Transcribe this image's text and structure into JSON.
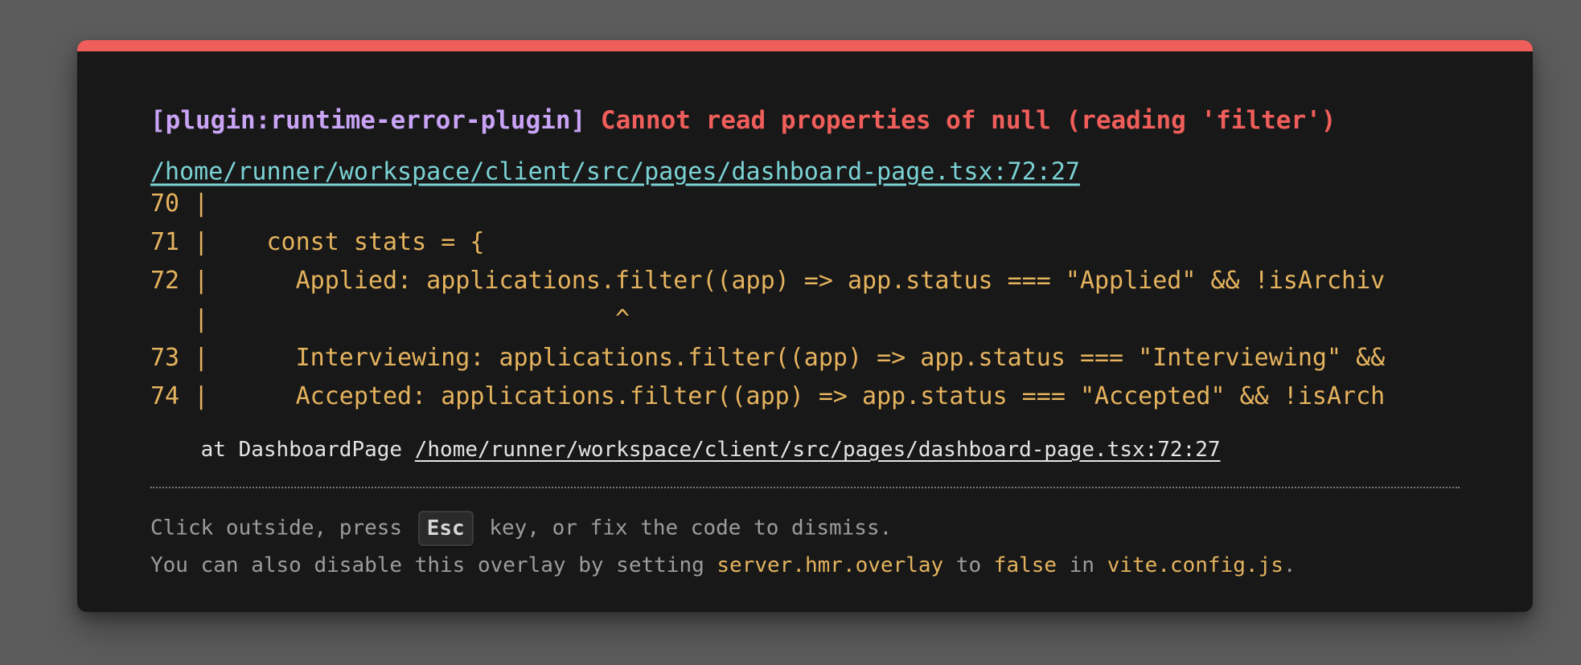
{
  "overlay": {
    "plugin": "[plugin:runtime-error-plugin]",
    "message": "Cannot read properties of null (reading 'filter')",
    "file": "/home/runner/workspace/client/src/pages/dashboard-page.tsx:72:27",
    "frame_lines": [
      "70 | ",
      "71 |    const stats = {",
      "72 |      Applied: applications.filter((app) => app.status === \"Applied\" && !isArchiv",
      "   |                            ^",
      "73 |      Interviewing: applications.filter((app) => app.status === \"Interviewing\" &&",
      "74 |      Accepted: applications.filter((app) => app.status === \"Accepted\" && !isArch"
    ],
    "stack_prefix": "at DashboardPage ",
    "stack_file": "/home/runner/workspace/client/src/pages/dashboard-page.tsx:72:27",
    "tip": {
      "line1_before": "Click outside, press ",
      "key": "Esc",
      "line1_after": " key, or fix the code to dismiss.",
      "line2_part1": "You can also disable this overlay by setting ",
      "line2_code1": "server.hmr.overlay",
      "line2_part2": " to ",
      "line2_code2": "false",
      "line2_part3": " in ",
      "line2_code3": "vite.config.js",
      "line2_end": "."
    }
  },
  "colors": {
    "accent_bar": "#ef5e5a",
    "plugin": "#c9a3f6",
    "error": "#ef5e5a",
    "file_link": "#7bd2d4",
    "code": "#e5b35e",
    "panel": "#181818",
    "backdrop": "#5c5c5c"
  }
}
